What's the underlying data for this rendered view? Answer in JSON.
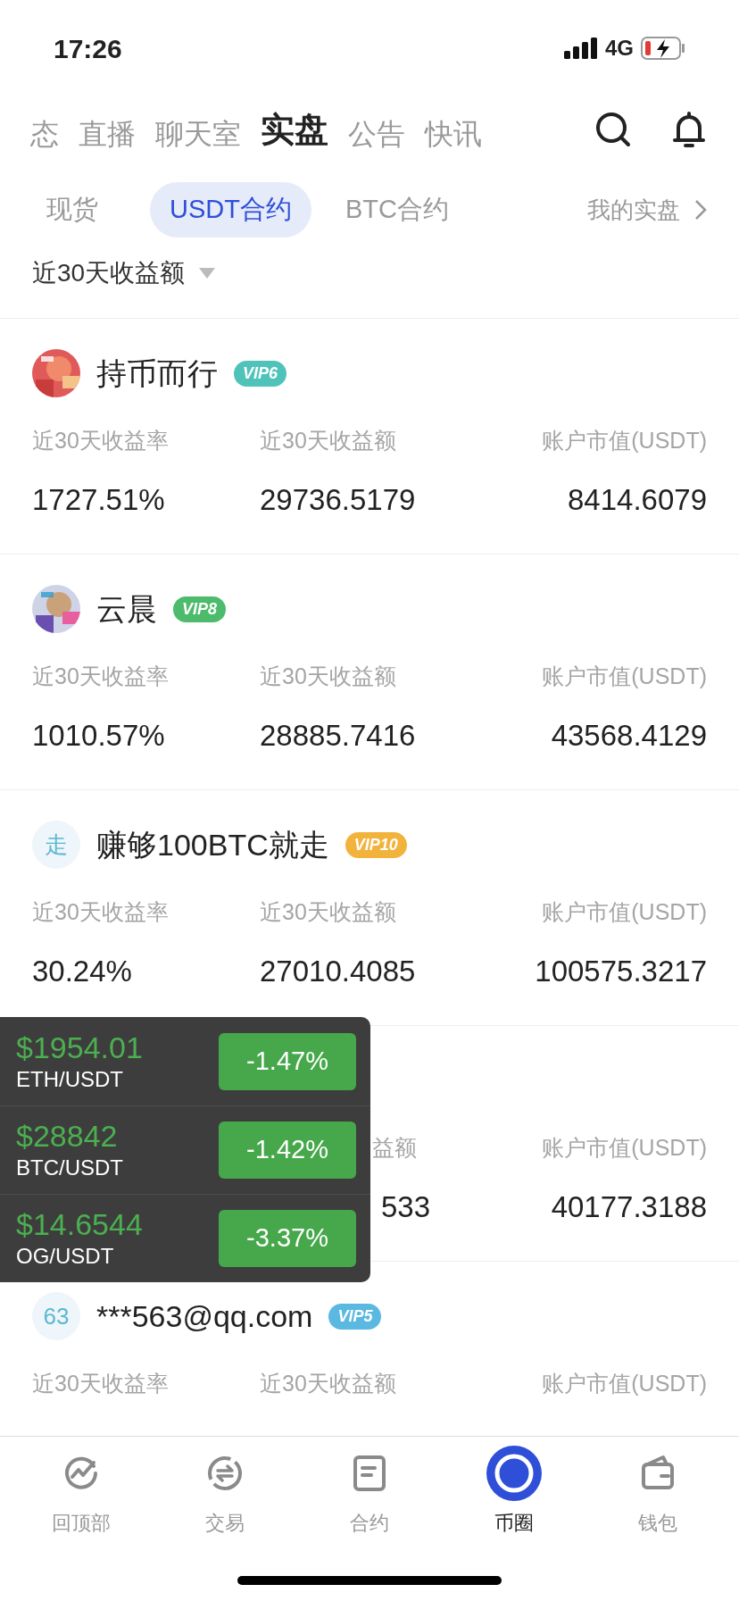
{
  "status_bar": {
    "time": "17:26",
    "network": "4G"
  },
  "top_tabs": [
    {
      "label": "态",
      "selected": false
    },
    {
      "label": "直播",
      "selected": false
    },
    {
      "label": "聊天室",
      "selected": false
    },
    {
      "label": "实盘",
      "selected": true
    },
    {
      "label": "公告",
      "selected": false
    },
    {
      "label": "快讯",
      "selected": false
    }
  ],
  "sub_tabs": [
    {
      "label": "现货",
      "selected": false
    },
    {
      "label": "USDT合约",
      "selected": true
    },
    {
      "label": "BTC合约",
      "selected": false
    }
  ],
  "my_link": "我的实盘",
  "sort": "近30天收益额",
  "traders": [
    {
      "kind": "full",
      "name": "持币而行",
      "vip": "VIP6",
      "color": "#4fc3b9",
      "labels": [
        "近30天收益率",
        "近30天收益额",
        "账户市值(USDT)"
      ],
      "values": [
        "1727.51%",
        "29736.5179",
        "8414.6079"
      ]
    },
    {
      "kind": "full",
      "name": "云晨",
      "vip": "VIP8",
      "color": "#4cbb6c",
      "labels": [
        "近30天收益率",
        "近30天收益额",
        "账户市值(USDT)"
      ],
      "values": [
        "1010.57%",
        "28885.7416",
        "43568.4129"
      ]
    },
    {
      "kind": "full",
      "avatar": {
        "kind": "text",
        "text": "走"
      },
      "name": "赚够100BTC就走",
      "vip": "VIP10",
      "color": "#f2b33d",
      "labels": [
        "近30天收益率",
        "近30天收益额",
        "账户市值(USDT)"
      ],
      "values": [
        "30.24%",
        "27010.4085",
        "100575.3217"
      ]
    },
    {
      "kind": "covered",
      "labels": [
        "益额",
        "账户市值(USDT)"
      ],
      "values": [
        "533",
        "40177.3188"
      ]
    },
    {
      "kind": "full",
      "avatar": {
        "kind": "text",
        "text": "63"
      },
      "name": "***563@qq.com",
      "vip": "VIP5",
      "color": "#5bb8e0",
      "labels": [
        "近30天收益率",
        "近30天收益额",
        "账户市值(USDT)"
      ]
    }
  ],
  "ticker": [
    {
      "price": "$1954.01",
      "pair": "ETH/USDT",
      "change": "-1.47%"
    },
    {
      "price": "$28842",
      "pair": "BTC/USDT",
      "change": "-1.42%"
    },
    {
      "price": "$14.6544",
      "pair": "OG/USDT",
      "change": "-3.37%"
    }
  ],
  "bottom_nav": [
    {
      "label": "回顶部",
      "selected": false
    },
    {
      "label": "交易",
      "selected": false
    },
    {
      "label": "合约",
      "selected": false
    },
    {
      "label": "币圈",
      "selected": true
    },
    {
      "label": "钱包",
      "selected": false
    }
  ]
}
